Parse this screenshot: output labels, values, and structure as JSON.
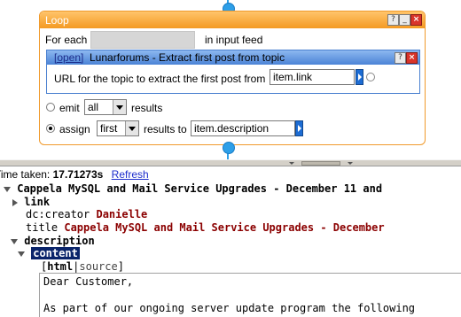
{
  "loop": {
    "title": "Loop",
    "help_button": "?",
    "minimize_button": "_",
    "maximize_button": "□",
    "close_button": "×",
    "for_each_label": "For each",
    "input_feed_label": "in input feed",
    "inner_module": {
      "open_link": "[open]",
      "title": "Lunarforums - Extract first post from topic",
      "help_button": "?",
      "close_button": "×",
      "url_label": "URL for the topic to extract the first post from",
      "url_value": "item.link"
    },
    "emit": {
      "label": "emit",
      "select_value": "all",
      "suffix": "results",
      "selected": false
    },
    "assign": {
      "label": "assign",
      "select_value": "first",
      "suffix": "results to",
      "target_value": "item.description",
      "selected": true
    }
  },
  "debug": {
    "time_label": "Time taken:",
    "time_value": "17.71273s",
    "refresh_link": "Refresh",
    "item_title": "Cappela MySQL and Mail Service Upgrades - December 11 and",
    "link_key": "link",
    "creator_key": "dc:creator",
    "creator_value": "Danielle",
    "title_key": "title",
    "title_value": "Cappela MySQL and Mail Service Upgrades - December",
    "description_key": "description",
    "content_key": "content",
    "view_open": "[",
    "view_html": "html",
    "view_sep": "|",
    "view_source": "source",
    "view_close": "]",
    "content_text": "Dear Customer,\n\nAs part of our ongoing server update program the following"
  },
  "colors": {
    "loop_border": "#f09a2c",
    "inner_border": "#4a80d0",
    "connector": "#2d9fe8",
    "value_text": "#8b0000",
    "link": "#1c2ccc"
  }
}
